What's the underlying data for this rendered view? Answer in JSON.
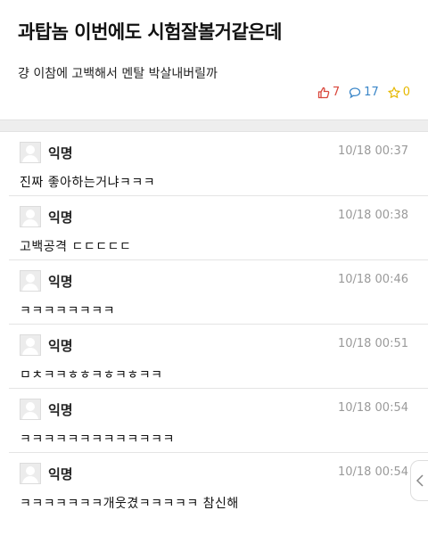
{
  "post": {
    "title": "과탑놈 이번에도 시험잘볼거같은데",
    "body": "걍 이참에 고백해서 멘탈 박살내버릴까",
    "likes": "7",
    "comments": "17",
    "scraps": "0"
  },
  "colors": {
    "like": "#d9473c",
    "comment": "#3a86c8",
    "scrap": "#e6b800"
  },
  "comments": [
    {
      "author": "익명",
      "time": "10/18 00:37",
      "text": "진짜 좋아하는거냐ㅋㅋㅋ"
    },
    {
      "author": "익명",
      "time": "10/18 00:38",
      "text": "고백공격 ㄷㄷㄷㄷㄷ"
    },
    {
      "author": "익명",
      "time": "10/18 00:46",
      "text": "ㅋㅋㅋㅋㅋㅋㅋㅋ"
    },
    {
      "author": "익명",
      "time": "10/18 00:51",
      "text": "ㅁㅊㅋㅋㅎㅎㅋㅎㅋㅎㅋㅋ"
    },
    {
      "author": "익명",
      "time": "10/18 00:54",
      "text": "ㅋㅋㅋㅋㅋㅋㅋㅋㅋㅋㅋㅋㅋ"
    },
    {
      "author": "익명",
      "time": "10/18 00:54",
      "text": "ㅋㅋㅋㅋㅋㅋㅋ개웃겼ㅋㅋㅋㅋㅋ 참신해"
    }
  ],
  "icons": {
    "like": "thumbs-up-icon",
    "comment": "comment-bubble-icon",
    "scrap": "star-icon",
    "side": "chevron-left-icon"
  }
}
